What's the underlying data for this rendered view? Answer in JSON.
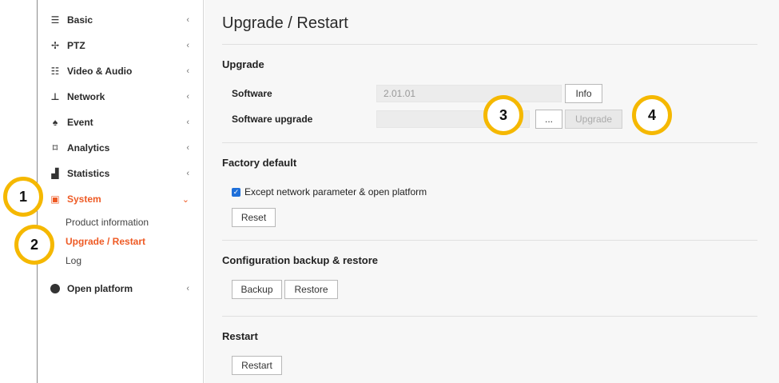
{
  "sidebar": {
    "items": [
      {
        "label": "Basic",
        "icon": "list-icon",
        "chevron": "‹"
      },
      {
        "label": "PTZ",
        "icon": "move-icon",
        "chevron": "‹"
      },
      {
        "label": "Video & Audio",
        "icon": "sliders-icon",
        "chevron": "‹"
      },
      {
        "label": "Network",
        "icon": "network-icon",
        "chevron": "‹"
      },
      {
        "label": "Event",
        "icon": "bell-icon",
        "chevron": "‹"
      },
      {
        "label": "Analytics",
        "icon": "frame-icon",
        "chevron": "‹"
      },
      {
        "label": "Statistics",
        "icon": "bar-chart-icon",
        "chevron": "‹"
      },
      {
        "label": "System",
        "icon": "system-icon",
        "chevron": "⌄"
      },
      {
        "label": "Open platform",
        "icon": "platform-icon",
        "chevron": "‹"
      }
    ],
    "system_sub": [
      {
        "label": "Product information"
      },
      {
        "label": "Upgrade / Restart"
      },
      {
        "label": "Log"
      }
    ],
    "active_color": "#ee5a24"
  },
  "main": {
    "title": "Upgrade / Restart",
    "upgrade": {
      "heading": "Upgrade",
      "software_label": "Software",
      "software_value": "2.01.01",
      "info_button": "Info",
      "software_upgrade_label": "Software upgrade",
      "file_input_value": "",
      "browse_button": "...",
      "upgrade_button": "Upgrade"
    },
    "factory": {
      "heading": "Factory default",
      "checkbox_label": "Except network parameter & open platform",
      "checked": true,
      "reset_button": "Reset"
    },
    "config": {
      "heading": "Configuration backup & restore",
      "backup_button": "Backup",
      "restore_button": "Restore"
    },
    "restart": {
      "heading": "Restart",
      "restart_button": "Restart"
    }
  },
  "callouts": {
    "c1": "1",
    "c2": "2",
    "c3": "3",
    "c4": "4",
    "color": "#f5b800"
  }
}
